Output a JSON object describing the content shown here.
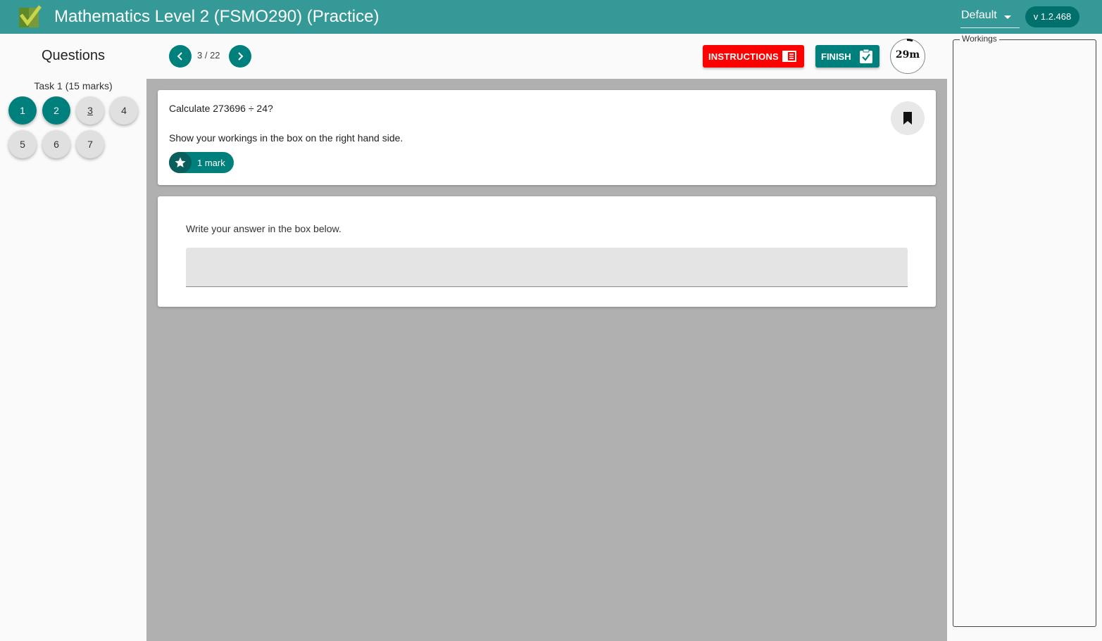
{
  "header": {
    "title": "Mathematics Level 2 (FSMO290) (Practice)",
    "theme": "Default",
    "version": "v 1.2.468",
    "bar_color": "#359a97"
  },
  "sidebar": {
    "heading": "Questions",
    "task_label": "Task 1 (15 marks)",
    "questions": [
      {
        "label": "1",
        "state": "answered"
      },
      {
        "label": "2",
        "state": "answered"
      },
      {
        "label": "3",
        "state": "current"
      },
      {
        "label": "4",
        "state": "unanswered"
      },
      {
        "label": "5",
        "state": "unanswered"
      },
      {
        "label": "6",
        "state": "unanswered"
      },
      {
        "label": "7",
        "state": "unanswered"
      }
    ]
  },
  "nav": {
    "counter": "3 / 22",
    "prev_icon": "chevron-left-icon",
    "next_icon": "chevron-right-icon"
  },
  "toolbar": {
    "instructions_label": "INSTRUCTIONS",
    "instructions_icon": "book-icon",
    "finish_label": "FINISH",
    "finish_icon": "clipboard-check-icon",
    "timer": "29m"
  },
  "question": {
    "text": "Calculate 273696 ÷ 24?",
    "instruction": "Show your workings in the box on the right hand side.",
    "marks": "1 mark",
    "bookmark_icon": "bookmark-icon"
  },
  "answer": {
    "instruction": "Write your answer in the box below.",
    "value": "",
    "placeholder": ""
  },
  "workings": {
    "label": "Workings"
  },
  "colors": {
    "accent": "#00807c",
    "danger": "#ff0000",
    "workspace": "#b0b0b0"
  }
}
